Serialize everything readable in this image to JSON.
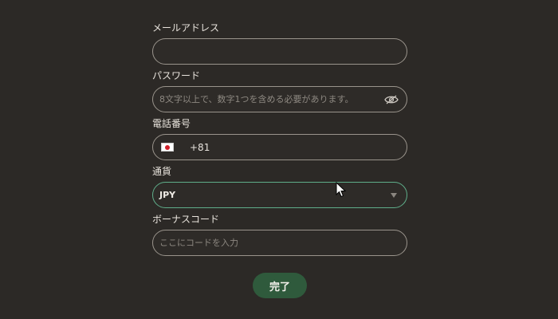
{
  "header": {
    "cut_text": "- - - -"
  },
  "form": {
    "email": {
      "label": "メールアドレス",
      "value": "",
      "placeholder": ""
    },
    "password": {
      "label": "パスワード",
      "value": "",
      "placeholder": "8文字以上で、数字1つを含める必要があります。",
      "icon": "eye-icon"
    },
    "phone": {
      "label": "電話番号",
      "country_flag": "japan-flag-icon",
      "dial_code": "+81"
    },
    "currency": {
      "label": "通貨",
      "selected": "JPY",
      "icon": "chevron-down-icon"
    },
    "bonus_code": {
      "label": "ボーナスコード",
      "value": "",
      "placeholder": "ここにコードを入力"
    }
  },
  "submit": {
    "label": "完了"
  },
  "colors": {
    "background": "#2c2926",
    "field_border": "#9a948c",
    "focus_border": "#5fae8a",
    "button": "#2f5a3c"
  }
}
